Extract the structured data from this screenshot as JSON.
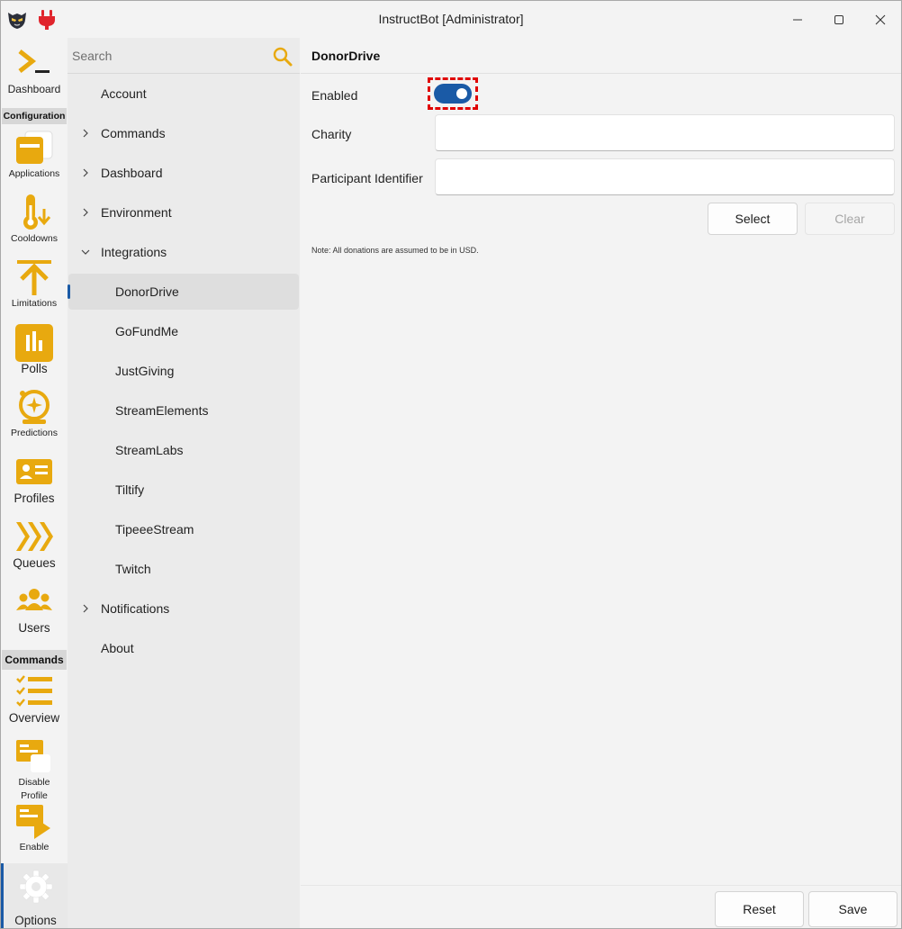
{
  "window": {
    "title": "InstructBot [Administrator]"
  },
  "colors": {
    "accent": "#1a5aa6",
    "icon_gold": "#e8a90f",
    "focus_dash": "#e00000"
  },
  "rail": {
    "dashboard": "Dashboard",
    "configuration_header": "Configuration",
    "applications": "Applications",
    "cooldowns": "Cooldowns",
    "limitations": "Limitations",
    "polls": "Polls",
    "predictions": "Predictions",
    "profiles": "Profiles",
    "queues": "Queues",
    "users": "Users",
    "commands_header": "Commands",
    "overview": "Overview",
    "disable_profile_1": "Disable",
    "disable_profile_2": "Profile",
    "enable": "Enable",
    "options": "Options"
  },
  "nav": {
    "search_placeholder": "Search",
    "items": {
      "account": "Account",
      "commands": "Commands",
      "dashboard": "Dashboard",
      "environment": "Environment",
      "integrations": "Integrations",
      "donordrive": "DonorDrive",
      "gofundme": "GoFundMe",
      "justgiving": "JustGiving",
      "streamelements": "StreamElements",
      "streamlabs": "StreamLabs",
      "tiltify": "Tiltify",
      "tipeeestream": "TipeeeStream",
      "twitch": "Twitch",
      "notifications": "Notifications",
      "about": "About"
    }
  },
  "main": {
    "title": "DonorDrive",
    "enabled_label": "Enabled",
    "enabled": true,
    "charity_label": "Charity",
    "charity_value": "",
    "participant_label": "Participant Identifier",
    "participant_value": "",
    "select_button": "Select",
    "clear_button": "Clear",
    "note": "Note: All donations are assumed to be in USD."
  },
  "footer": {
    "reset_button": "Reset",
    "save_button": "Save"
  }
}
